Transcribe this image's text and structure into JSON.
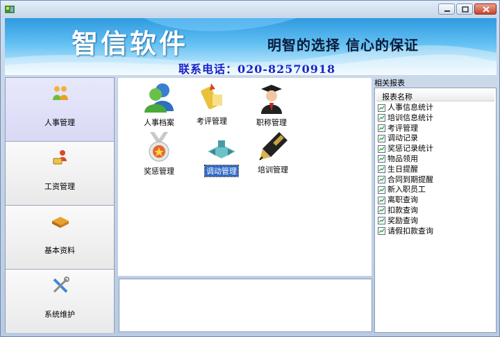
{
  "banner": {
    "title": "智信软件",
    "slogan": "明智的选择 信心的保证",
    "phone": "联系电话：020-82570918"
  },
  "sidebar": {
    "items": [
      {
        "label": "人事管理",
        "icon": "people-icon",
        "active": true
      },
      {
        "label": "工资管理",
        "icon": "salary-icon",
        "active": false
      },
      {
        "label": "基本资料",
        "icon": "book-icon",
        "active": false
      },
      {
        "label": "系统维护",
        "icon": "tools-icon",
        "active": false
      }
    ]
  },
  "modules": [
    {
      "label": "人事档案",
      "icon": "user-profile-icon"
    },
    {
      "label": "考评管理",
      "icon": "evaluation-icon"
    },
    {
      "label": "职称管理",
      "icon": "graduate-icon"
    },
    {
      "label": "奖惩管理",
      "icon": "medal-icon"
    },
    {
      "label": "调动管理",
      "icon": "transfer-icon",
      "selected": true
    },
    {
      "label": "培训管理",
      "icon": "pen-icon"
    }
  ],
  "reports": {
    "title": "相关报表",
    "column_header": "报表名称",
    "items": [
      "人事信息统计",
      "培训信息统计",
      "考评管理",
      "调动记录",
      "奖惩记录统计",
      "物品领用",
      "生日提醒",
      "合同到期提醒",
      "新入职员工",
      "离职查询",
      "扣款查询",
      "奖励查询",
      "请假扣款查询"
    ]
  },
  "colors": {
    "selection": "#3169c6",
    "phone_text": "#1a23c4",
    "active_sidebar": "#dcdcf7"
  }
}
